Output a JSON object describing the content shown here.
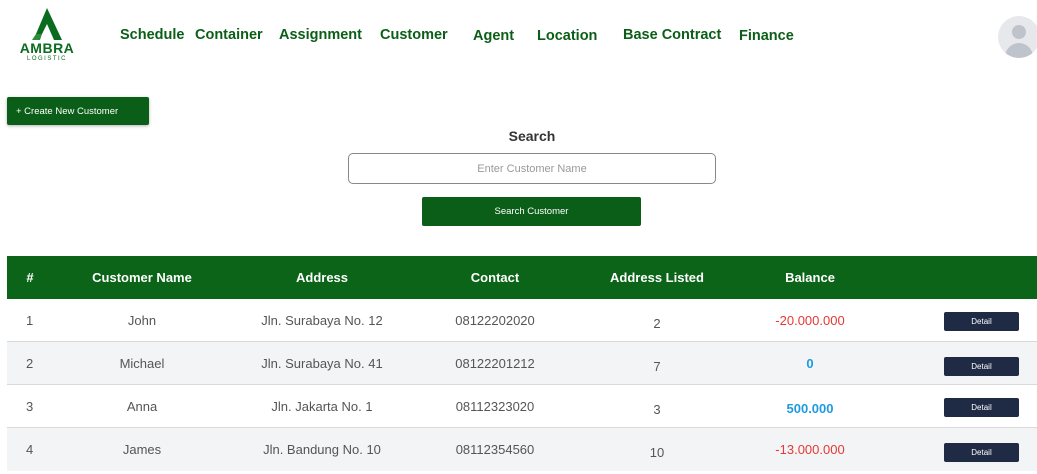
{
  "brand": {
    "name": "AMBRA",
    "tagline": "LOGISTIC",
    "color": "#0b6b1e"
  },
  "nav": {
    "items": [
      "Schedule",
      "Container",
      "Assignment",
      "Customer",
      "Agent",
      "Location",
      "Base Contract",
      "Finance"
    ]
  },
  "actions": {
    "create_label": "+ Create New Customer"
  },
  "search": {
    "title": "Search",
    "placeholder": "Enter Customer Name",
    "button_label": "Search Customer"
  },
  "table": {
    "headers": [
      "#",
      "Customer Name",
      "Address",
      "Contact",
      "Address Listed",
      "Balance"
    ],
    "rows": [
      {
        "index": "1",
        "name": "John",
        "address": "Jln. Surabaya No. 12",
        "contact": "08122202020",
        "listed": "2",
        "balance": "-20.000.000",
        "balance_type": "negative",
        "action": "Detail"
      },
      {
        "index": "2",
        "name": "Michael",
        "address": "Jln. Surabaya No. 41",
        "contact": "08122201212",
        "listed": "7",
        "balance": "0",
        "balance_type": "positive",
        "action": "Detail"
      },
      {
        "index": "3",
        "name": "Anna",
        "address": "Jln. Jakarta No. 1",
        "contact": "08112323020",
        "listed": "3",
        "balance": "500.000",
        "balance_type": "positive",
        "action": "Detail"
      },
      {
        "index": "4",
        "name": "James",
        "address": "Jln. Bandung No. 10",
        "contact": "08112354560",
        "listed": "10",
        "balance": "-13.000.000",
        "balance_type": "negative",
        "action": "Detail"
      }
    ]
  },
  "colors": {
    "primary": "#0b5e17",
    "header_bg": "#0b6418",
    "negative": "#e53935",
    "positive": "#1e9be0",
    "detail_button": "#1f2a44"
  }
}
